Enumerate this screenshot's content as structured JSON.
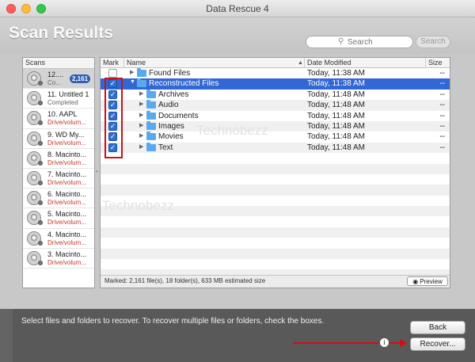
{
  "window": {
    "title": "Data Rescue 4"
  },
  "header": {
    "title": "Scan Results",
    "search_placeholder": "Search",
    "search_button": "Search",
    "search_icon": "magnifier-icon"
  },
  "scans": {
    "header": "Scans",
    "items": [
      {
        "name": "12....",
        "sub": "Co...",
        "badge": "2,161",
        "status": "ok",
        "selected": true
      },
      {
        "name": "11. Untitled 1",
        "sub": "Completed",
        "status": "ok"
      },
      {
        "name": "10. AAPL",
        "sub": "Drive/volum...",
        "status": "error"
      },
      {
        "name": "9. WD My...",
        "sub": "Drive/volum...",
        "status": "error"
      },
      {
        "name": "8. Macinto...",
        "sub": "Drive/volum...",
        "status": "error"
      },
      {
        "name": "7. Macinto...",
        "sub": "Drive/volum...",
        "status": "error"
      },
      {
        "name": "6. Macinto...",
        "sub": "Drive/volum...",
        "status": "error"
      },
      {
        "name": "5. Macinto...",
        "sub": "Drive/volum...",
        "status": "error"
      },
      {
        "name": "4. Macinto...",
        "sub": "Drive/volum...",
        "status": "error"
      },
      {
        "name": "3. Macinto...",
        "sub": "Drive/volum...",
        "status": "error"
      }
    ]
  },
  "files": {
    "columns": {
      "mark": "Mark",
      "name": "Name",
      "date": "Date Modified",
      "size": "Size"
    },
    "rows": [
      {
        "name": "Found Files",
        "date": "Today, 11:38 AM",
        "size": "--",
        "checked": false,
        "level": 0,
        "expanded": false
      },
      {
        "name": "Reconstructed Files",
        "date": "Today, 11:38 AM",
        "size": "--",
        "checked": true,
        "level": 0,
        "expanded": true,
        "highlight": true
      },
      {
        "name": "Archives",
        "date": "Today, 11:48 AM",
        "size": "--",
        "checked": true,
        "level": 1,
        "expanded": false
      },
      {
        "name": "Audio",
        "date": "Today, 11:48 AM",
        "size": "--",
        "checked": true,
        "level": 1,
        "expanded": false
      },
      {
        "name": "Documents",
        "date": "Today, 11:48 AM",
        "size": "--",
        "checked": true,
        "level": 1,
        "expanded": false
      },
      {
        "name": "Images",
        "date": "Today, 11:48 AM",
        "size": "--",
        "checked": true,
        "level": 1,
        "expanded": false
      },
      {
        "name": "Movies",
        "date": "Today, 11:48 AM",
        "size": "--",
        "checked": true,
        "level": 1,
        "expanded": false
      },
      {
        "name": "Text",
        "date": "Today, 11:48 AM",
        "size": "--",
        "checked": true,
        "level": 1,
        "expanded": false
      }
    ],
    "status": "Marked: 2,161 file(s), 18 folder(s), 633 MB estimated size",
    "preview_button": "Preview"
  },
  "watermark": "Technobezz",
  "bottom": {
    "instructions": "Select files and folders to recover. To recover multiple files or folders, check the boxes.",
    "back_button": "Back",
    "recover_button": "Recover..."
  }
}
